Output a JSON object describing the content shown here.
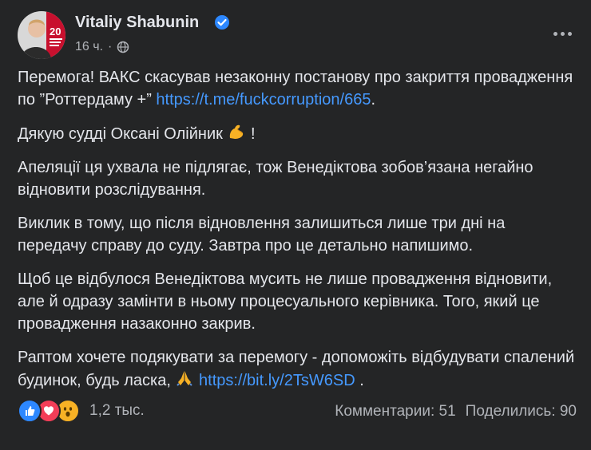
{
  "author": {
    "name": "Vitaliy Shabunin",
    "avatar_badge": "20",
    "verified": true
  },
  "meta": {
    "time": "16 ч.",
    "separator": "·",
    "audience_icon": "globe-icon"
  },
  "paragraphs": {
    "p1_text": "Перемога! ВАКС скасував незаконну постанову про закриття провадження по ”Роттердаму +” ",
    "p1_link": "https://t.me/fuckcorruption/665",
    "p1_end": ".",
    "p2_text": "Дякую судді Оксані Олійник ",
    "p2_emoji": "flexed-biceps-emoji",
    "p2_end": " !",
    "p3": "Апеляції ця ухвала не підлягає, тож Венедіктова зобов’язана негайно відновити розслідування.",
    "p4": "Виклик в тому, що після відновлення залишиться лише три дні на передачу справу до суду. Завтра про це детально напишимо.",
    "p5": "Щоб це відбулося Венедіктова мусить не лише провадження відновити, але й одразу замінти в ньому процесуального керівника. Того, який це провадження назаконно закрив.",
    "p6_text": "Раптом хочете подякувати за перемогу - допоможіть відбудувати спалений будинок, будь ласка, ",
    "p6_emoji": "folded-hands-emoji",
    "p6_link": "https://bit.ly/2TsW6SD",
    "p6_end": " ."
  },
  "footer": {
    "reactions": [
      "like",
      "love",
      "wow"
    ],
    "reaction_count": "1,2 тыс.",
    "comments": "Комментарии: 51",
    "shares": "Поделились: 90"
  },
  "colors": {
    "background": "#242526",
    "text": "#e4e6eb",
    "secondary_text": "#b0b3b8",
    "link": "#4599ff",
    "verified": "#2d88ff"
  }
}
